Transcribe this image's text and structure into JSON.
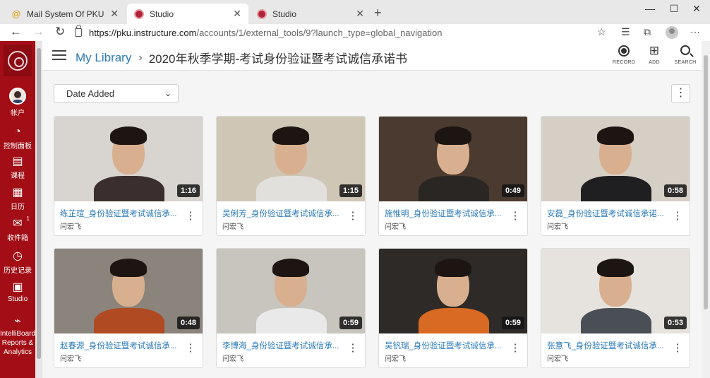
{
  "browser": {
    "tabs": [
      {
        "label": "Mail System Of PKU",
        "active": false
      },
      {
        "label": "Studio",
        "active": true
      },
      {
        "label": "Studio",
        "active": false
      }
    ],
    "url_host": "https://pku.instructure.com",
    "url_path": "/accounts/1/external_tools/9?launch_type=global_navigation"
  },
  "gnav": {
    "items": [
      {
        "label": "帐户",
        "icon": "account-avatar"
      },
      {
        "label": "控制面板",
        "icon": "dashboard-icon"
      },
      {
        "label": "课程",
        "icon": "courses-icon"
      },
      {
        "label": "日历",
        "icon": "calendar-icon"
      },
      {
        "label": "收件箱",
        "icon": "inbox-icon",
        "badge": "1"
      },
      {
        "label": "历史记录",
        "icon": "history-icon"
      },
      {
        "label": "Studio",
        "icon": "studio-icon"
      },
      {
        "label": "IntelliBoard Reports & Analytics",
        "icon": "intelliboard-icon"
      }
    ]
  },
  "header": {
    "library_link": "My Library",
    "collection_title": "2020年秋季学期-考试身份验证暨考试诚信承诺书",
    "record_label": "RECORD",
    "add_label": "ADD",
    "search_label": "SEARCH"
  },
  "toolbar": {
    "sort_value": "Date Added"
  },
  "videos": [
    {
      "title": "练芷瑄_身份验证暨考试诚信承...",
      "owner": "闫宏飞",
      "duration": "1:16",
      "bg": "#d8d4cf",
      "body": "#3a2f2e"
    },
    {
      "title": "吴俐芳_身份验证暨考试诚信承...",
      "owner": "闫宏飞",
      "duration": "1:15",
      "bg": "#cfc6b6",
      "body": "#e2e0dc"
    },
    {
      "title": "施惟明_身份验证暨考试诚信承...",
      "owner": "闫宏飞",
      "duration": "0:49",
      "bg": "#4a3a30",
      "body": "#2a2624"
    },
    {
      "title": "安磊_身份验证暨考试诚信承诺...",
      "owner": "闫宏飞",
      "duration": "0:58",
      "bg": "#d5cfc6",
      "body": "#1f1f22"
    },
    {
      "title": "赵春源_身份验证暨考试诚信承...",
      "owner": "闫宏飞",
      "duration": "0:48",
      "bg": "#8a847c",
      "body": "#b04a22"
    },
    {
      "title": "李博海_身份验证暨考试诚信承...",
      "owner": "闫宏飞",
      "duration": "0:59",
      "bg": "#c8c4be",
      "body": "#e9e9e9"
    },
    {
      "title": "吴钒瑞_身份验证暨考试诚信承...",
      "owner": "闫宏飞",
      "duration": "0:59",
      "bg": "#2e2a28",
      "body": "#d86a24"
    },
    {
      "title": "张意飞_身份验证暨考试诚信承...",
      "owner": "闫宏飞",
      "duration": "0:53",
      "bg": "#e6e3de",
      "body": "#4a4f55"
    }
  ]
}
